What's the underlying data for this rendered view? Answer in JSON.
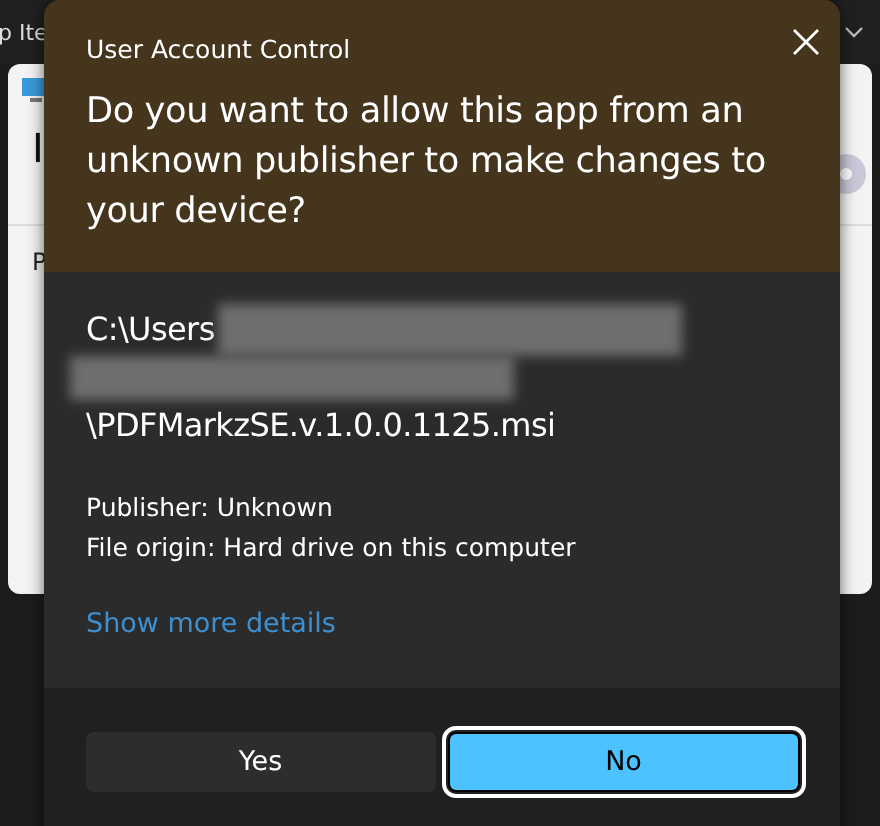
{
  "background_window": {
    "taskbar_label": "p Ite",
    "heading": "I",
    "section_label": "P"
  },
  "dialog": {
    "title": "User Account Control",
    "question": "Do you want to allow this app from an unknown publisher to make changes to your device?",
    "path_start": "C:\\Users",
    "path_end": "\\PDFMarkzSE.v.1.0.0.1125.msi",
    "details": [
      "Publisher: Unknown",
      "File origin: Hard drive on this computer"
    ],
    "more_link": "Show more details",
    "buttons": [
      {
        "label": "Yes",
        "selected": false
      },
      {
        "label": "No",
        "selected": true
      }
    ]
  }
}
